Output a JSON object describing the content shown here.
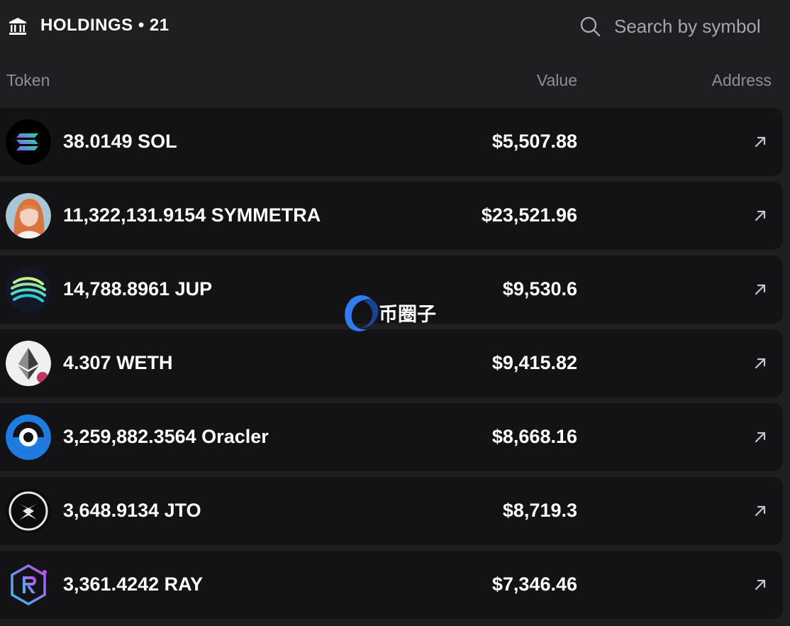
{
  "header": {
    "title": "HOLDINGS • 21",
    "search_placeholder": "Search by symbol"
  },
  "columns": {
    "token": "Token",
    "value": "Value",
    "address": "Address"
  },
  "holdings": [
    {
      "amount": "38.0149 SOL",
      "value": "$5,507.88",
      "icon": "solana-icon"
    },
    {
      "amount": "11,322,131.9154 SYMMETRA",
      "value": "$23,521.96",
      "icon": "symmetra-avatar-icon"
    },
    {
      "amount": "14,788.8961 JUP",
      "value": "$9,530.6",
      "icon": "jupiter-icon"
    },
    {
      "amount": "4.307 WETH",
      "value": "$9,415.82",
      "icon": "ethereum-icon"
    },
    {
      "amount": "3,259,882.3564 Oracler",
      "value": "$8,668.16",
      "icon": "oracler-icon"
    },
    {
      "amount": "3,648.9134 JTO",
      "value": "$8,719.3",
      "icon": "jito-icon"
    },
    {
      "amount": "3,361.4242 RAY",
      "value": "$7,346.46",
      "icon": "raydium-icon"
    }
  ],
  "watermark": {
    "text": "币圈子"
  },
  "colors": {
    "background": "#1f1f22",
    "row": "#131316",
    "muted": "#8e8e95",
    "accent_blue": "#2f7cf0"
  }
}
